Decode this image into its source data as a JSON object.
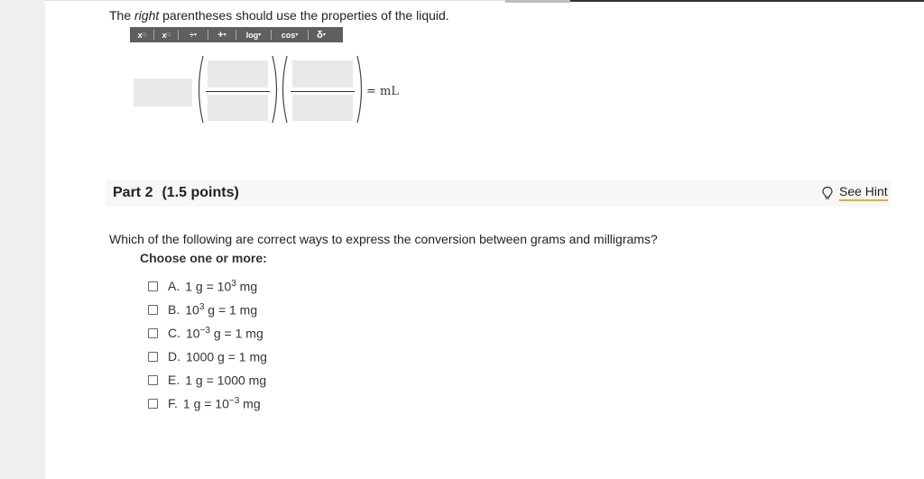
{
  "instruction": {
    "prefix": "The ",
    "emph": "right",
    "suffix": " parentheses should use the properties of the liquid."
  },
  "toolbar": {
    "buttons": [
      {
        "name": "superscript-button",
        "label": "x",
        "mark": "□"
      },
      {
        "name": "subscript-button",
        "label": "x",
        "mark": "□"
      },
      {
        "name": "fraction-button",
        "label": "÷",
        "mark": "▾"
      },
      {
        "name": "plus-button",
        "label": "+",
        "mark": "▾"
      },
      {
        "name": "log-button",
        "label": "log",
        "mark": "▾"
      },
      {
        "name": "cos-button",
        "label": "cos",
        "mark": "▾"
      },
      {
        "name": "delta-button",
        "label": "δ",
        "mark": "▾"
      }
    ]
  },
  "equation": {
    "unit": "= mL"
  },
  "part": {
    "title": "Part 2",
    "points": "(1.5 points)",
    "hint": "See Hint"
  },
  "question": {
    "text": "Which of the following are correct ways to express the conversion between grams and milligrams?",
    "choose": "Choose one or more:",
    "options": [
      {
        "letter": "A.",
        "pre": "1 g = 10",
        "sup": "3",
        "post": " mg"
      },
      {
        "letter": "B.",
        "pre": "10",
        "sup": "3",
        "post": " g = 1 mg"
      },
      {
        "letter": "C.",
        "pre": "10",
        "sup": "−3",
        "post": " g = 1 mg"
      },
      {
        "letter": "D.",
        "pre": "1000 g = 1 mg",
        "sup": "",
        "post": ""
      },
      {
        "letter": "E.",
        "pre": "1 g = 1000 mg",
        "sup": "",
        "post": ""
      },
      {
        "letter": "F.",
        "pre": "1 g = 10",
        "sup": "−3",
        "post": " mg"
      }
    ]
  }
}
